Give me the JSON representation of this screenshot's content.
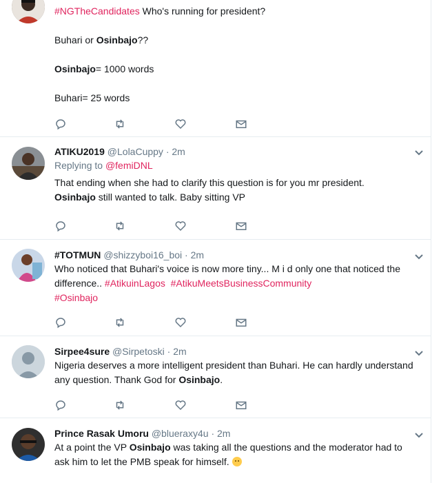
{
  "colors": {
    "hashtag": "#e0245e",
    "meta": "#657786",
    "text": "#14171a",
    "divider": "#e6ecf0"
  },
  "tweets": [
    {
      "hashtag": "#NGTheCandidates",
      "text_after_hashtag": " Who's running for president?",
      "line2_a": "Buhari or ",
      "line2_b": "Osinbajo",
      "line2_c": "??",
      "line3_a": "Osinbajo",
      "line3_b": "= 1000 words",
      "line4": "Buhari= 25 words"
    },
    {
      "fullname": "ATIKU2019",
      "handle": "@LolaCuppy",
      "time": "2m",
      "reply_label": "Replying to ",
      "reply_mention": "@femiDNL",
      "text_a": "That ending when she had to clarify this question is for you mr president.",
      "text_b": "Osinbajo",
      "text_c": " still wanted to talk. Baby sitting VP"
    },
    {
      "fullname": "#TOTMUN",
      "handle": "@shizzyboi16_boi",
      "time": "2m",
      "text_a": "Who noticed that Buhari's voice is now more tiny... M i d only one that noticed the difference.. ",
      "hashtag1": "#AtikuinLagos",
      "hashtag2": "#AtikuMeetsBusinessCommunity",
      "hashtag3": "#Osinbajo"
    },
    {
      "fullname": "Sirpee4sure",
      "handle": "@Sirpetoski",
      "time": "2m",
      "text_a": "Nigeria deserves a more intelligent president than Buhari. He can hardly understand any question. Thank God for ",
      "text_b": "Osinbajo",
      "text_c": "."
    },
    {
      "fullname": "Prince Rasak Umoru",
      "handle": "@blueraxy4u",
      "time": "2m",
      "text_a": "At a point the VP ",
      "text_b": "Osinbajo",
      "text_c": " was taking all the questions and the moderator had to ask him to let the PMB speak for himself. "
    }
  ],
  "icons": [
    "reply-icon",
    "retweet-icon",
    "like-icon",
    "message-icon",
    "caret-down-icon"
  ],
  "dot": "·"
}
